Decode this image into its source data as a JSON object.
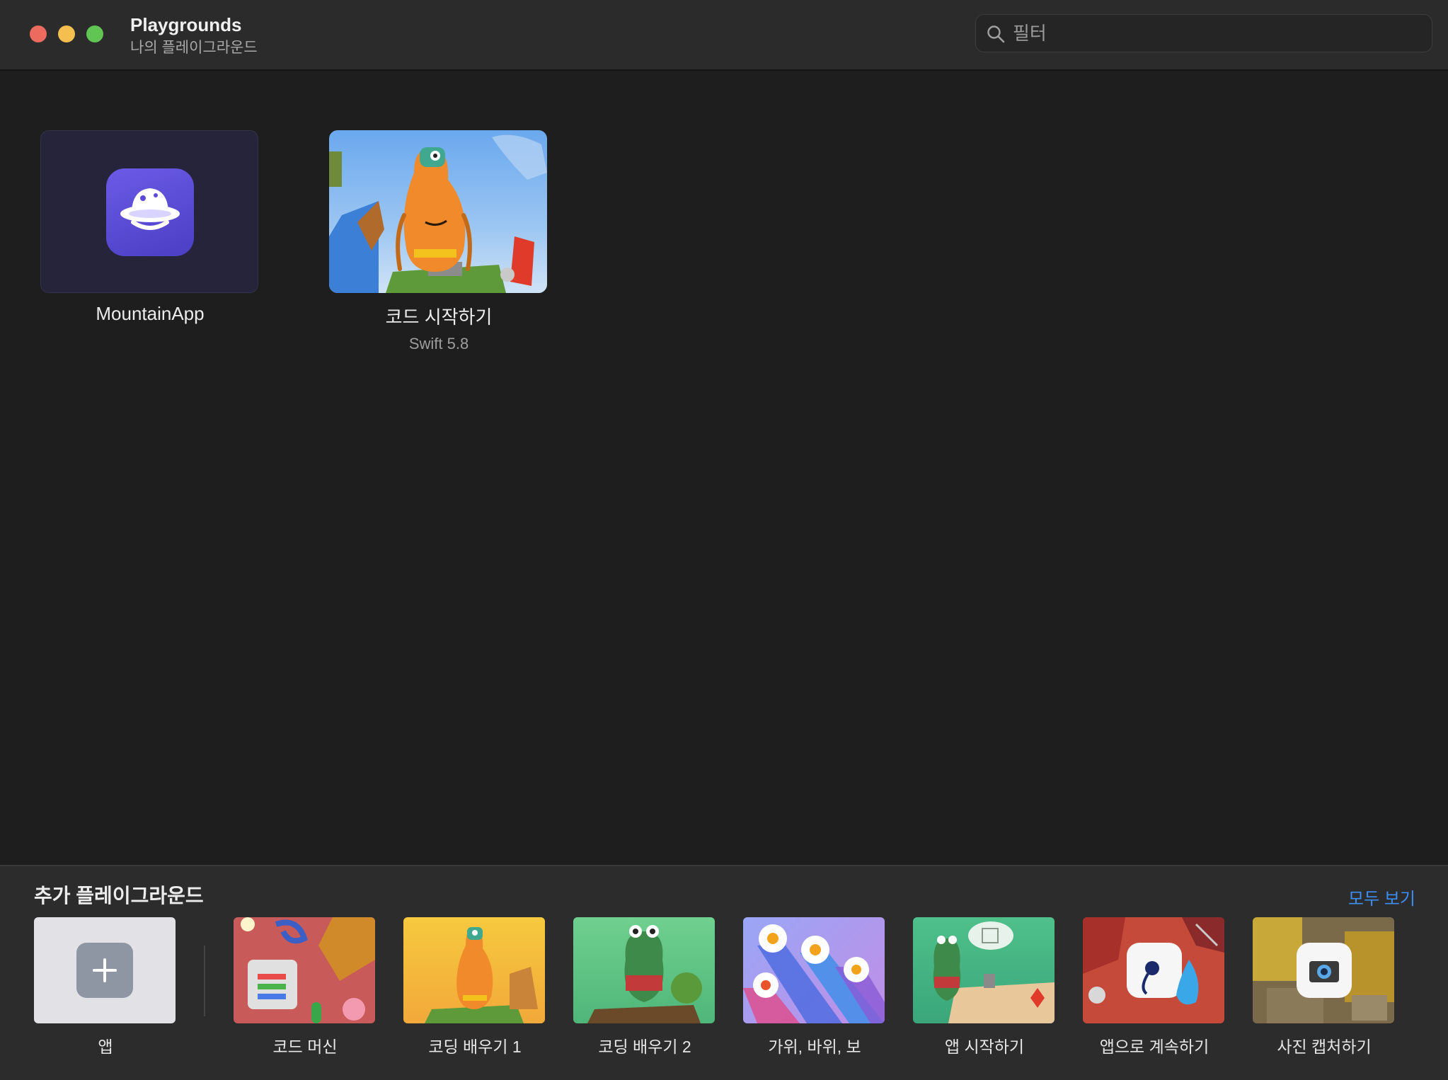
{
  "window": {
    "title": "Playgrounds",
    "subtitle": "나의 플레이그라운드"
  },
  "search": {
    "placeholder": "필터",
    "value": ""
  },
  "my_playgrounds": [
    {
      "name": "MountainApp",
      "subtitle": ""
    },
    {
      "name": "코드 시작하기",
      "subtitle": "Swift 5.8"
    }
  ],
  "more_playgrounds": {
    "title": "추가 플레이그라운드",
    "see_all": "모두 보기",
    "templates": [
      {
        "label": "앱"
      },
      {
        "label": "코드 머신"
      },
      {
        "label": "코딩 배우기 1"
      },
      {
        "label": "코딩 배우기 2"
      },
      {
        "label": "가위, 바위, 보"
      },
      {
        "label": "앱 시작하기"
      },
      {
        "label": "앱으로 계속하기"
      },
      {
        "label": "사진 캡처하기"
      }
    ]
  },
  "colors": {
    "accent": "#3d8ef7",
    "window_bg": "#1e1e1e",
    "titlebar_bg": "#2b2b2b",
    "bottom_bg": "#2c2c2c"
  }
}
